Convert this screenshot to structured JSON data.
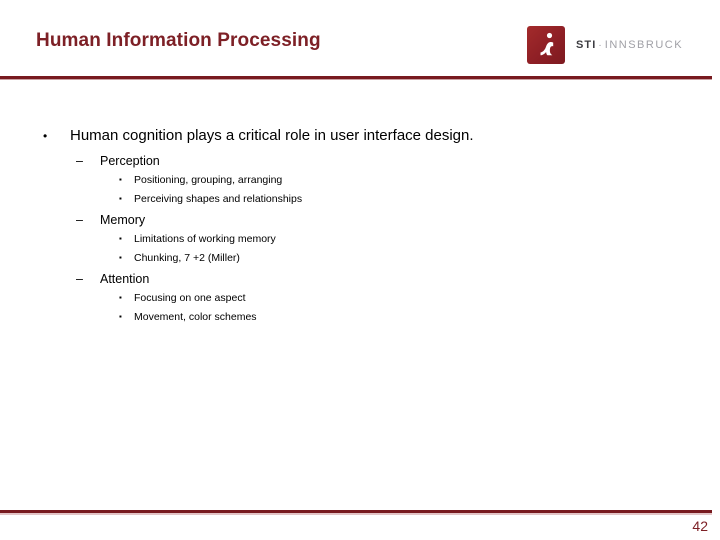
{
  "slide": {
    "title": "Human Information Processing",
    "page_number": "42",
    "accent_color": "#7d2026",
    "rule_color": "#781a1f"
  },
  "logo": {
    "mark_name": "sti-person-logo-icon",
    "mark_color": "#8e1f25",
    "sti": "STI",
    "separator": "·",
    "innsbruck": "INNSBRUCK"
  },
  "bullets": {
    "level1": {
      "marker": "•",
      "text": "Human cognition plays a critical role in user interface design."
    },
    "groups": [
      {
        "marker": "–",
        "label": "Perception",
        "items": [
          {
            "marker": "▪",
            "text": "Positioning, grouping, arranging"
          },
          {
            "marker": "▪",
            "text": "Perceiving shapes and relationships"
          }
        ]
      },
      {
        "marker": "–",
        "label": "Memory",
        "items": [
          {
            "marker": "▪",
            "text": "Limitations of working memory"
          },
          {
            "marker": "▪",
            "text": "Chunking, 7 +2 (Miller)"
          }
        ]
      },
      {
        "marker": "–",
        "label": "Attention",
        "items": [
          {
            "marker": "▪",
            "text": "Focusing on one aspect"
          },
          {
            "marker": "▪",
            "text": "Movement, color schemes"
          }
        ]
      }
    ]
  }
}
